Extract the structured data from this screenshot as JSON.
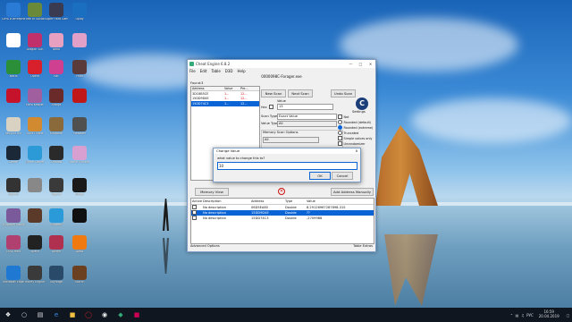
{
  "desktop": {
    "icons": [
      {
        "id": "i1",
        "label": "Сеть и Интернет",
        "color": "#2a7bd6"
      },
      {
        "id": "i2",
        "label": "",
        "color": "#ffffff"
      },
      {
        "id": "i3",
        "label": "Mario",
        "color": "#2b8f3a"
      },
      {
        "id": "i4",
        "label": "",
        "color": "#c4132a"
      },
      {
        "id": "i5",
        "label": "Recycle Bin",
        "color": "#d9d2c3"
      },
      {
        "id": "i6",
        "label": "Steam",
        "color": "#1b2838"
      },
      {
        "id": "i7",
        "label": "Skyrim",
        "color": "#333333"
      },
      {
        "id": "i8",
        "label": "Kingdom Rising",
        "color": "#7a5a9a"
      },
      {
        "id": "i9",
        "label": "TERA Hero",
        "color": "#b04070"
      },
      {
        "id": "i10",
        "label": "Microsoft Edge",
        "color": "#1f78d1"
      },
      {
        "id": "i11",
        "label": "Warframe",
        "color": "#3a4b62"
      },
      {
        "id": "i12",
        "label": "Tree of Savior",
        "color": "#6a8a3a"
      },
      {
        "id": "i13",
        "label": "Dragon Sun",
        "color": "#c0306a"
      },
      {
        "id": "i14",
        "label": "Opera",
        "color": "#d8202c"
      },
      {
        "id": "i15",
        "label": "Hero Keeper",
        "color": "#a060a0"
      },
      {
        "id": "i16",
        "label": "Luna Online",
        "color": "#d28a30"
      },
      {
        "id": "i17",
        "label": "Game Center",
        "color": "#2d9ad8"
      },
      {
        "id": "i18",
        "label": "",
        "color": "#888888"
      },
      {
        "id": "i19",
        "label": "",
        "color": "#5b3a2a"
      },
      {
        "id": "i20",
        "label": "Spark",
        "color": "#222222"
      },
      {
        "id": "i21",
        "label": "Honey Engine",
        "color": "#3a3a3a"
      },
      {
        "id": "i22",
        "label": "World Adventure",
        "color": "#a02020"
      },
      {
        "id": "i23",
        "label": "Super Hard Game",
        "color": "#3a3a50"
      },
      {
        "id": "i24",
        "label": "Neko",
        "color": "#e8a0c0"
      },
      {
        "id": "i25",
        "label": "Kat",
        "color": "#d04090"
      },
      {
        "id": "i26",
        "label": "Shaiya",
        "color": "#6a2a2a"
      },
      {
        "id": "i27",
        "label": "Kingdom",
        "color": "#8a6a3a"
      },
      {
        "id": "i28",
        "label": "Shadow",
        "color": "#2a2a2a"
      },
      {
        "id": "i29",
        "label": "Age of",
        "color": "#3a3a3a"
      },
      {
        "id": "i30",
        "label": "uTorrent",
        "color": "#2a9ad8"
      },
      {
        "id": "i31",
        "label": "Anime",
        "color": "#b03050"
      },
      {
        "id": "i32",
        "label": "Skyforge",
        "color": "#2a4a6a"
      },
      {
        "id": "i33",
        "label": "Dragon",
        "color": "#a02828"
      },
      {
        "id": "i34",
        "label": "Uplay",
        "color": "#1a6fc0"
      },
      {
        "id": "i35",
        "label": "",
        "color": "#e0a0c8"
      },
      {
        "id": "i36",
        "label": "Pixel",
        "color": "#5a3a3a"
      },
      {
        "id": "i37",
        "label": "",
        "color": "#c01818"
      },
      {
        "id": "i38",
        "label": "Forsaken",
        "color": "#505050"
      },
      {
        "id": "i39",
        "label": "Brave Frontier",
        "color": "#d8a0d0"
      },
      {
        "id": "i40",
        "label": "Ghost",
        "color": "#1a1a1a"
      },
      {
        "id": "i41",
        "label": "",
        "color": "#101010"
      },
      {
        "id": "i42",
        "label": "Avast",
        "color": "#f07a10"
      },
      {
        "id": "i43",
        "label": "Scorch",
        "color": "#6a4020"
      },
      {
        "id": "i44",
        "label": "",
        "color": "#303030"
      },
      {
        "id": "i45",
        "label": "Dreamlight",
        "color": "#d04080"
      }
    ]
  },
  "ce": {
    "window_title": "Cheat Engine 6.8.2",
    "menu": [
      "File",
      "Edit",
      "Table",
      "D3D",
      "Help"
    ],
    "process": "0000098C-Forager.exe",
    "found": "Found:3",
    "results_headers": [
      "Address",
      "Value",
      "Pre..."
    ],
    "results": [
      {
        "address": "3DC6B5CE",
        "value": "1...",
        "prev": "12...",
        "selected": false
      },
      {
        "address": "15DD9D4E",
        "value": "1...",
        "prev": "12...",
        "selected": false
      },
      {
        "address": "15DD74C3",
        "value": "1...",
        "prev": "12...",
        "selected": true
      }
    ],
    "new_scan": "New Scan",
    "next_scan": "Next Scan",
    "undo_scan": "Undo Scan",
    "settings": "Settings",
    "value_label": "Value",
    "hex_label": "Hex",
    "value": "13",
    "scan_type_label": "Scan Type",
    "scan_type": "Exact Value",
    "value_type_label": "Value Type",
    "value_type": "All",
    "memory_scan_options": "Memory Scan Options",
    "mem_option": "All",
    "not_label": "Not",
    "rounded_default": "Rounded (default)",
    "rounded_extreme": "Rounded (extreme)",
    "truncated": "Truncated",
    "simple_values": "Simple values only",
    "unrandomizer": "Unrandomizer",
    "speedhack": "Speedhack",
    "memory_view": "Memory View",
    "add_manually": "Add Address Manually",
    "table_headers": [
      "Active",
      "Description",
      "Address",
      "Type",
      "Value"
    ],
    "table_rows": [
      {
        "description": "No description",
        "address": "06D5EA80",
        "type": "Double",
        "value": "8.29126967287898-315",
        "selected": false
      },
      {
        "description": "No description",
        "address": "15DD9D4E",
        "type": "Double",
        "value": "??",
        "selected": true
      },
      {
        "description": "No description",
        "address": "15DD74C3",
        "type": "Double",
        "value": "-2709988",
        "selected": false
      }
    ],
    "advanced_options": "Advanced Options",
    "table_extras": "Table Extras"
  },
  "dialog": {
    "title": "Change Value",
    "close": "X",
    "prompt": "what value to change this to?",
    "value": "10",
    "ok": "OK",
    "cancel": "Cancel"
  },
  "taskbar": {
    "time": "16:59",
    "date": "20.04.2019",
    "lang": "РУС"
  }
}
